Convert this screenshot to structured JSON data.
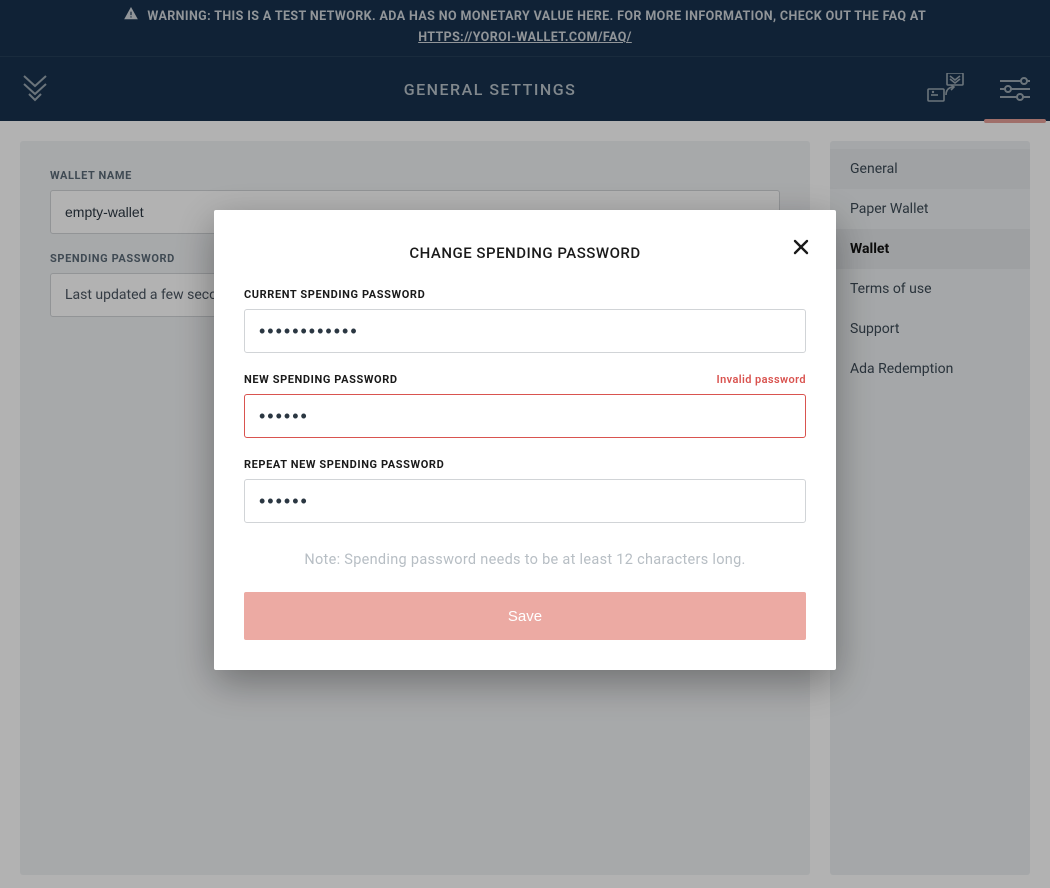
{
  "warning": {
    "text_part1": "WARNING: THIS IS A TEST NETWORK. ADA HAS NO MONETARY VALUE HERE. FOR MORE INFORMATION, CHECK OUT THE FAQ AT",
    "link_text": "HTTPS://YOROI-WALLET.COM/FAQ/"
  },
  "header": {
    "title": "GENERAL SETTINGS"
  },
  "main": {
    "wallet_name_label": "WALLET NAME",
    "wallet_name_value": "empty-wallet",
    "spending_password_label": "SPENDING PASSWORD",
    "spending_password_info": "Last updated a few seconds ago"
  },
  "sidebar": {
    "items": [
      {
        "label": "General",
        "active": false
      },
      {
        "label": "Paper Wallet",
        "active": false
      },
      {
        "label": "Wallet",
        "active": true
      },
      {
        "label": "Terms of use",
        "active": false
      },
      {
        "label": "Support",
        "active": false
      },
      {
        "label": "Ada Redemption",
        "active": false
      }
    ]
  },
  "modal": {
    "title": "CHANGE SPENDING PASSWORD",
    "fields": {
      "current": {
        "label": "CURRENT SPENDING PASSWORD",
        "value": "••••••••••••",
        "error": ""
      },
      "new": {
        "label": "NEW SPENDING PASSWORD",
        "value": "••••••",
        "error": "Invalid password"
      },
      "repeat": {
        "label": "REPEAT NEW SPENDING PASSWORD",
        "value": "••••••",
        "error": ""
      }
    },
    "note": "Note: Spending password needs to be at least 12 characters long.",
    "save_label": "Save"
  }
}
